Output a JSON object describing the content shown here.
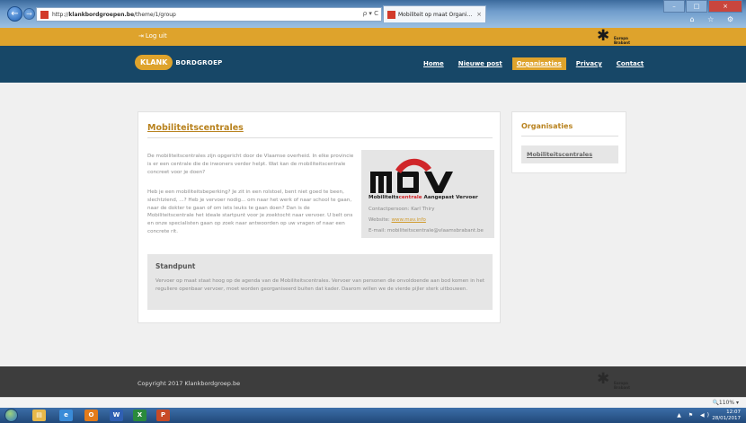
{
  "browser": {
    "url_prefix": "http://",
    "url_domain": "klankbordgroepen.be",
    "url_path": "/theme/1/group",
    "search_glyph": "ρ ▾ C",
    "tab_title": "Mobiliteit op maat Organi...",
    "tab_close": "×",
    "back_glyph": "←",
    "forward_glyph": "→",
    "chrome_icons": "⌂ ☆ ⚙",
    "window_controls": [
      "–",
      "□",
      "×"
    ]
  },
  "topbar": {
    "logout_icon": "⇥",
    "logout_label": "Log uit",
    "star": "✱",
    "star_text_1": "Europa",
    "star_text_2": "Brabant"
  },
  "nav": {
    "logo_badge": "KLANK",
    "logo_text": "BORDGROEP",
    "items": [
      {
        "label": "Home",
        "active": false
      },
      {
        "label": "Nieuwe post",
        "active": false
      },
      {
        "label": "Organisaties",
        "active": true
      },
      {
        "label": "Privacy",
        "active": false
      },
      {
        "label": "Contact",
        "active": false
      }
    ]
  },
  "main": {
    "title": "Mobiliteitscentrales",
    "paragraph_1": "De mobiliteitscentrales zijn opgericht door de Vlaamse overheid. In elke provincie is er een centrale die de inwoners verder helpt. Wat kan de mobiliteitscentrale concreet voor je doen?",
    "paragraph_2": "Heb je een mobiliteitsbeperking? Je zit in een rolstoel, bent niet goed te been, slechtziend, ...? Heb je vervoer nodig... om naar het werk of naar school te gaan, naar de dokter te gaan of om iets leuks te gaan doen? Dan is de Mobiliteitscentrale het ideale startpunt voor je zoektocht naar vervoer. U belt ons en onze specialisten gaan op zoek naar antwoorden op uw vragen of naar een concrete rit.",
    "org": {
      "logo_letters": "MOV",
      "tagline_part1": "Mobiliteits",
      "tagline_part2": "centrale",
      "tagline_part3": " Aangepast Vervoer",
      "contact_label": "Contactpersoon: Karl Thiry",
      "website_label": "Website: ",
      "website_link": "www.mav.info",
      "email_label": "E-mail: mobiliteitscentrale@vlaamsbrabant.be"
    },
    "standpunt": {
      "heading": "Standpunt",
      "text": "Vervoer op maat staat hoog op de agenda van de Mobiliteitscentrales. Vervoer van personen die onvoldoende aan bod komen in het reguliere openbaar vervoer, moet worden georganiseerd buiten dat kader. Daarom willen we de vierde pijler sterk uitbouwen."
    }
  },
  "sidebar": {
    "title": "Organisaties",
    "items": [
      {
        "label": "Mobiliteitscentrales"
      }
    ]
  },
  "footer": {
    "copyright": "Copyright 2017 Klankbordgroep.be",
    "star": "✱",
    "star_text_1": "Europa",
    "star_text_2": "Brabant"
  },
  "statusbar": {
    "zoom": "🔍110% ▾"
  },
  "taskbar": {
    "apps": [
      {
        "name": "explorer",
        "glyph": "▤",
        "color": "#e8b84a"
      },
      {
        "name": "ie",
        "glyph": "e",
        "color": "#3a8bd8"
      },
      {
        "name": "outlook",
        "glyph": "O",
        "color": "#e37b19"
      },
      {
        "name": "word",
        "glyph": "W",
        "color": "#2f5fb3"
      },
      {
        "name": "excel",
        "glyph": "X",
        "color": "#2a8a3c"
      },
      {
        "name": "powerpoint",
        "glyph": "P",
        "color": "#c84a26"
      }
    ],
    "tray_icons": "▲ ⚑ ◀)",
    "time": "12:07",
    "date": "28/01/2017"
  },
  "colors": {
    "accent": "#dea32c",
    "nav_bg": "#174767",
    "footer_bg": "#3d3d3d",
    "title": "#b8821e"
  }
}
